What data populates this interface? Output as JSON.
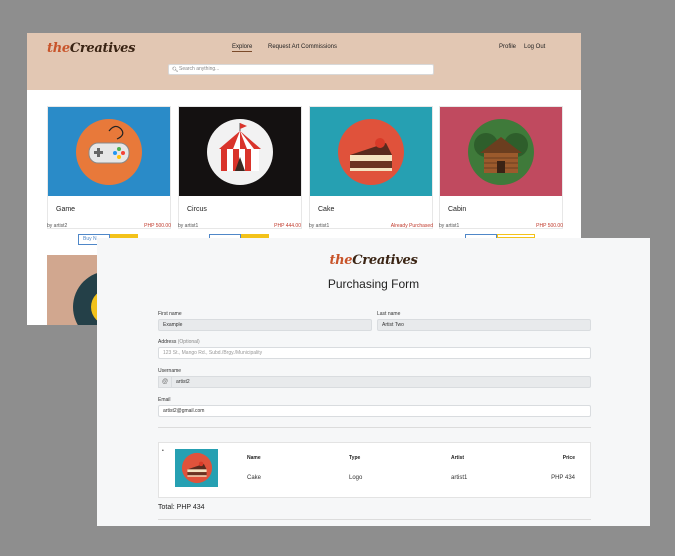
{
  "app": {
    "logo_prefix": "the",
    "logo_suffix": "Creatives"
  },
  "header": {
    "nav_explore": "Explore",
    "nav_request": "Request Art Commissions",
    "nav_profile": "Profile",
    "nav_logout": "Log Out",
    "search_placeholder": "Search anything..."
  },
  "cards": [
    {
      "title": "Game",
      "artist": "by artist2",
      "price": "PHP 500.00",
      "bg": "#2a8bc8",
      "button": "Buy N"
    },
    {
      "title": "Circus",
      "artist": "by artist1",
      "price": "PHP 444.00",
      "bg": "#141111"
    },
    {
      "title": "Cake",
      "artist": "by artist1",
      "status": "Already Purchased",
      "bg": "#26a0b2"
    },
    {
      "title": "Cabin",
      "artist": "by artist1",
      "price": "PHP 500.00",
      "bg": "#c04a5f"
    }
  ],
  "form": {
    "title": "Purchasing Form",
    "first_name_label": "First name",
    "first_name_value": "Example",
    "last_name_label": "Last name",
    "last_name_value": "Artist Two",
    "address_label": "Address",
    "address_optional": "(Optional)",
    "address_placeholder": "123 St., Mango Rd., Subd./Brgy./Municipality",
    "username_label": "Username",
    "username_prefix": "@",
    "username_value": "artist2",
    "email_label": "Email",
    "email_value": "artist2@gmail.com"
  },
  "order": {
    "bullet": "•",
    "headers": {
      "name": "Name",
      "type": "Type",
      "artist": "Artist",
      "price": "Price"
    },
    "row": {
      "name": "Cake",
      "type": "Logo",
      "artist": "artist1",
      "price": "PHP 434"
    },
    "total": "Total: PHP 434"
  },
  "colors": {
    "header_bg": "#e2c7b3",
    "accent_red": "#c0392b",
    "button_blue": "#4f87c8",
    "button_yellow": "#f3c21a"
  }
}
